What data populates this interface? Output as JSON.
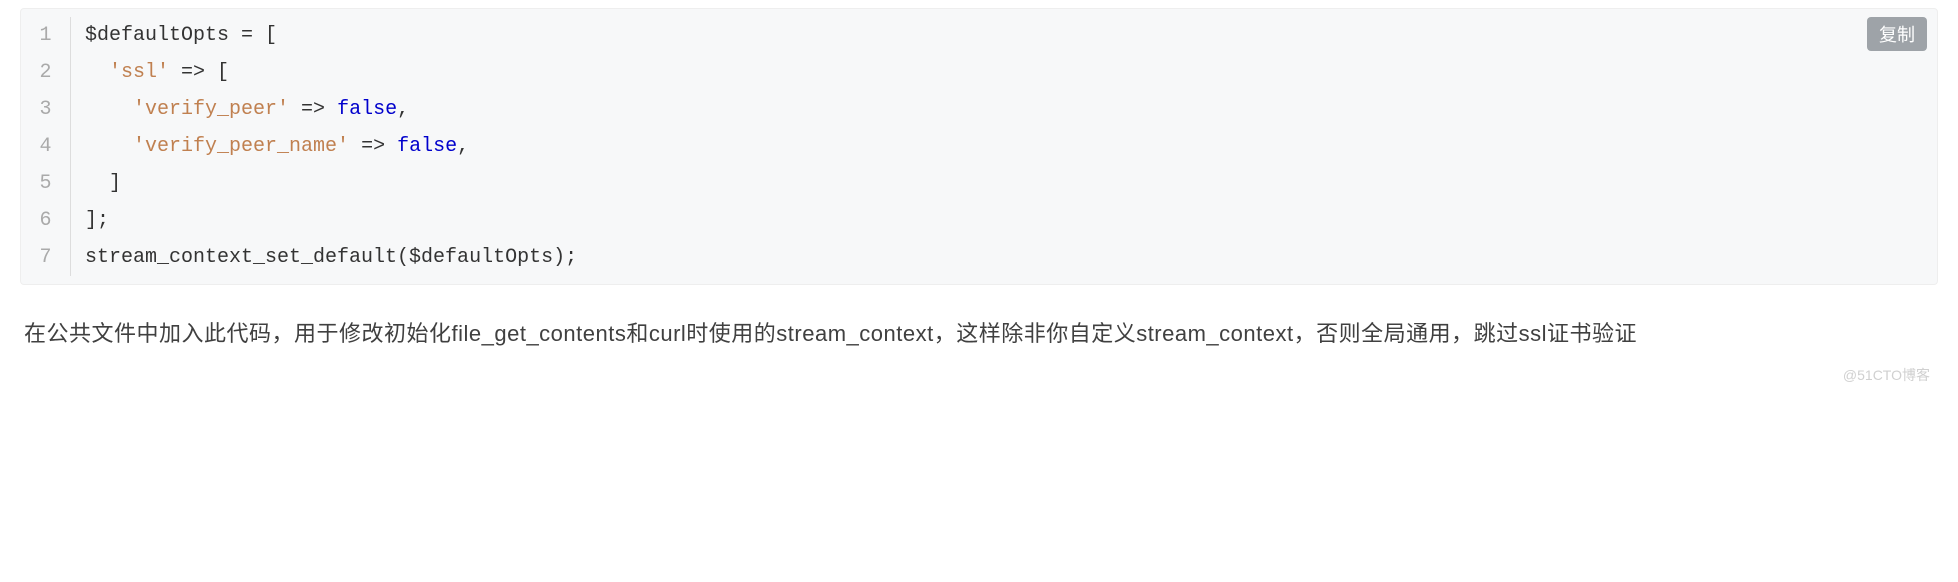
{
  "copy_label": "复制",
  "code": {
    "lines": [
      {
        "num": "1",
        "segments": [
          {
            "t": "$defaultOpts = [",
            "c": ""
          }
        ]
      },
      {
        "num": "2",
        "segments": [
          {
            "t": "  ",
            "c": ""
          },
          {
            "t": "'ssl'",
            "c": "s"
          },
          {
            "t": " => [",
            "c": ""
          }
        ]
      },
      {
        "num": "3",
        "segments": [
          {
            "t": "    ",
            "c": ""
          },
          {
            "t": "'verify_peer'",
            "c": "s"
          },
          {
            "t": " => ",
            "c": ""
          },
          {
            "t": "false",
            "c": "b"
          },
          {
            "t": ",",
            "c": ""
          }
        ]
      },
      {
        "num": "4",
        "segments": [
          {
            "t": "    ",
            "c": ""
          },
          {
            "t": "'verify_peer_name'",
            "c": "s"
          },
          {
            "t": " => ",
            "c": ""
          },
          {
            "t": "false",
            "c": "b"
          },
          {
            "t": ",",
            "c": ""
          }
        ]
      },
      {
        "num": "5",
        "segments": [
          {
            "t": "  ]",
            "c": ""
          }
        ]
      },
      {
        "num": "6",
        "segments": [
          {
            "t": "];",
            "c": ""
          }
        ]
      },
      {
        "num": "7",
        "segments": [
          {
            "t": "stream_context_set_default($defaultOpts);",
            "c": ""
          }
        ]
      }
    ]
  },
  "paragraph": "在公共文件中加入此代码，用于修改初始化file_get_contents和curl时使用的stream_context，这样除非你自定义stream_context，否则全局通用，跳过ssl证书验证",
  "watermark": "@51CTO博客"
}
